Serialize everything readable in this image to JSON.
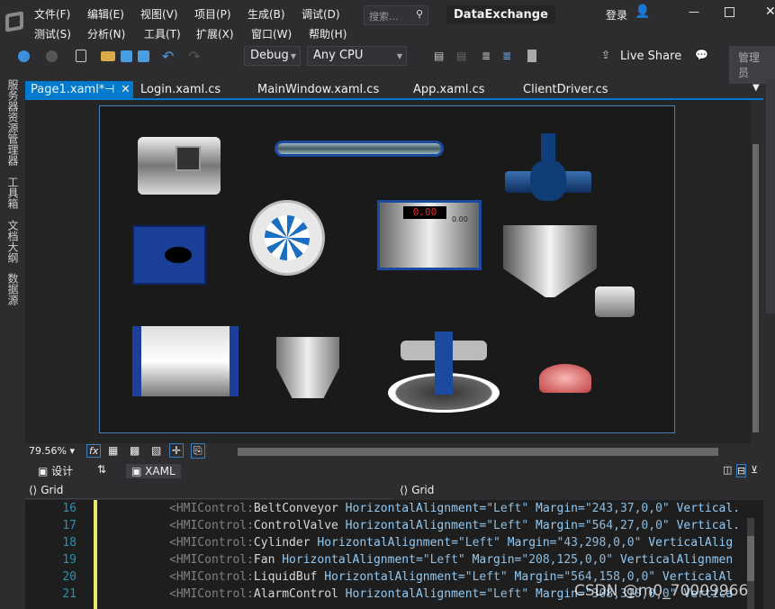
{
  "title": "DataExchange",
  "search_placeholder": "搜索...",
  "login": "登录",
  "menu_row1": [
    "文件(F)",
    "编辑(E)",
    "视图(V)",
    "项目(P)",
    "生成(B)",
    "调试(D)"
  ],
  "menu_row2": [
    "测试(S)",
    "分析(N)",
    "工具(T)",
    "扩展(X)",
    "窗口(W)",
    "帮助(H)"
  ],
  "toolbar": {
    "config": "Debug",
    "platform": "Any CPU",
    "live_share": "Live Share",
    "admin": "管理员"
  },
  "left_panels": [
    "服务器资源管理器",
    "工具箱",
    "文档大纲",
    "数据源"
  ],
  "tabs": [
    "Page1.xaml*",
    "Login.xaml.cs",
    "MainWindow.xaml.cs",
    "App.xaml.cs",
    "ClientDriver.cs"
  ],
  "designer": {
    "display_value": "0.00",
    "small_value": "0.00",
    "zoom": "79.56%"
  },
  "view_tabs": {
    "design": "设计",
    "xaml": "XAML"
  },
  "scope": {
    "left": "Grid",
    "right": "Grid"
  },
  "code": [
    {
      "n": "16",
      "ctl": "BeltConveyor",
      "margin": "243,37,0,0",
      "rest": " Vertical."
    },
    {
      "n": "17",
      "ctl": "ControlValve",
      "margin": "564,27,0,0",
      "rest": " Vertical."
    },
    {
      "n": "18",
      "ctl": "Cylinder",
      "margin": "43,298,0,0",
      "rest": " VerticalAlig"
    },
    {
      "n": "19",
      "ctl": "Fan",
      "margin": "208,125,0,0",
      "rest": " VerticalAlignmen"
    },
    {
      "n": "20",
      "ctl": "LiquidBuf",
      "margin": "564,158,0,0",
      "rest": " VerticalAl"
    },
    {
      "n": "21",
      "ctl": "AlarmControl",
      "margin": "308,310,0,0",
      "rest": " Vertica"
    }
  ],
  "code_tokens": {
    "prefix": "<HMIControl:",
    "attr1": "HorizontalAlignment=",
    "val1": "\"Left\"",
    "attr2": "Margin="
  },
  "watermark": "CSDN @m0_70009966"
}
